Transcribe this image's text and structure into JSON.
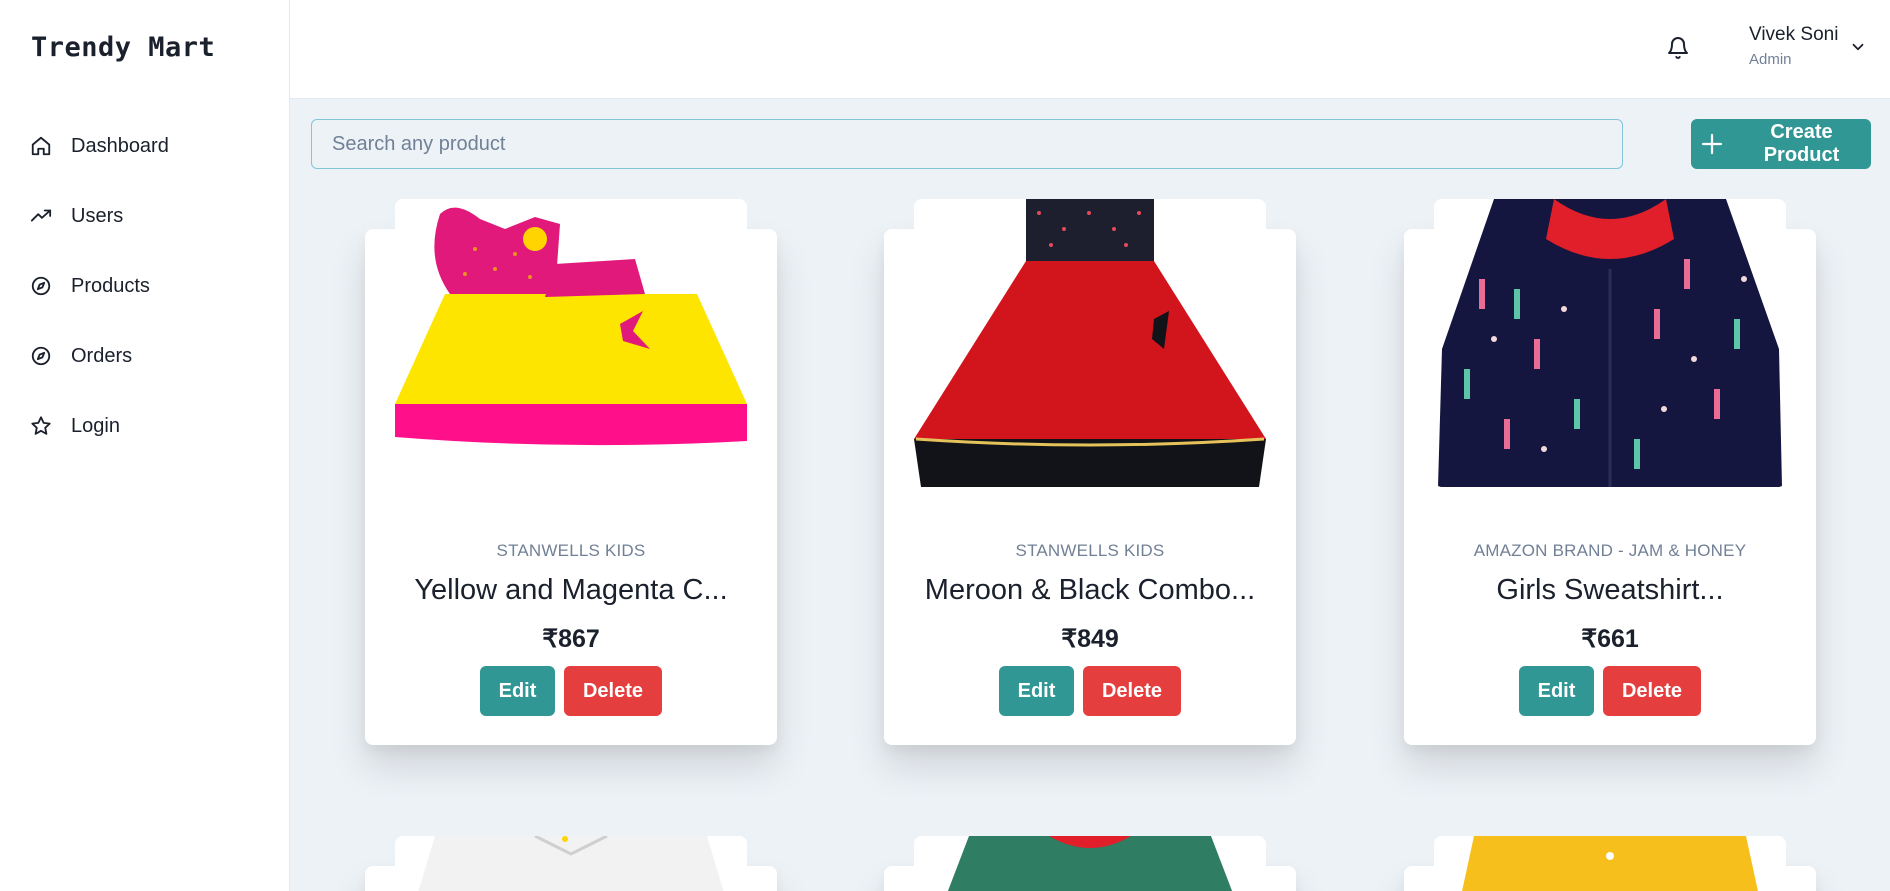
{
  "app": {
    "title": "Trendy Mart"
  },
  "sidebar": {
    "items": [
      {
        "label": "Dashboard",
        "icon": "home-icon"
      },
      {
        "label": "Users",
        "icon": "trending-up-icon"
      },
      {
        "label": "Products",
        "icon": "compass-icon"
      },
      {
        "label": "Orders",
        "icon": "compass-icon"
      },
      {
        "label": "Login",
        "icon": "star-icon"
      }
    ]
  },
  "header": {
    "user_name": "Vivek Soni",
    "user_role": "Admin",
    "notification_icon": "bell-icon",
    "menu_icon": "chevron-down-icon"
  },
  "search": {
    "placeholder": "Search any product",
    "value": ""
  },
  "actions": {
    "create_label": "Create Product"
  },
  "colors": {
    "accent": "#319795",
    "danger": "#e53e3e",
    "background": "#edf2f7"
  },
  "products": [
    {
      "brand": "STANWELLS KIDS",
      "title": "Yellow and Magenta C...",
      "price": "₹867",
      "edit_label": "Edit",
      "delete_label": "Delete"
    },
    {
      "brand": "STANWELLS KIDS",
      "title": "Meroon & Black Combo...",
      "price": "₹849",
      "edit_label": "Edit",
      "delete_label": "Delete"
    },
    {
      "brand": "AMAZON BRAND - JAM & HONEY",
      "title": "Girls Sweatshirt...",
      "price": "₹661",
      "edit_label": "Edit",
      "delete_label": "Delete"
    }
  ]
}
